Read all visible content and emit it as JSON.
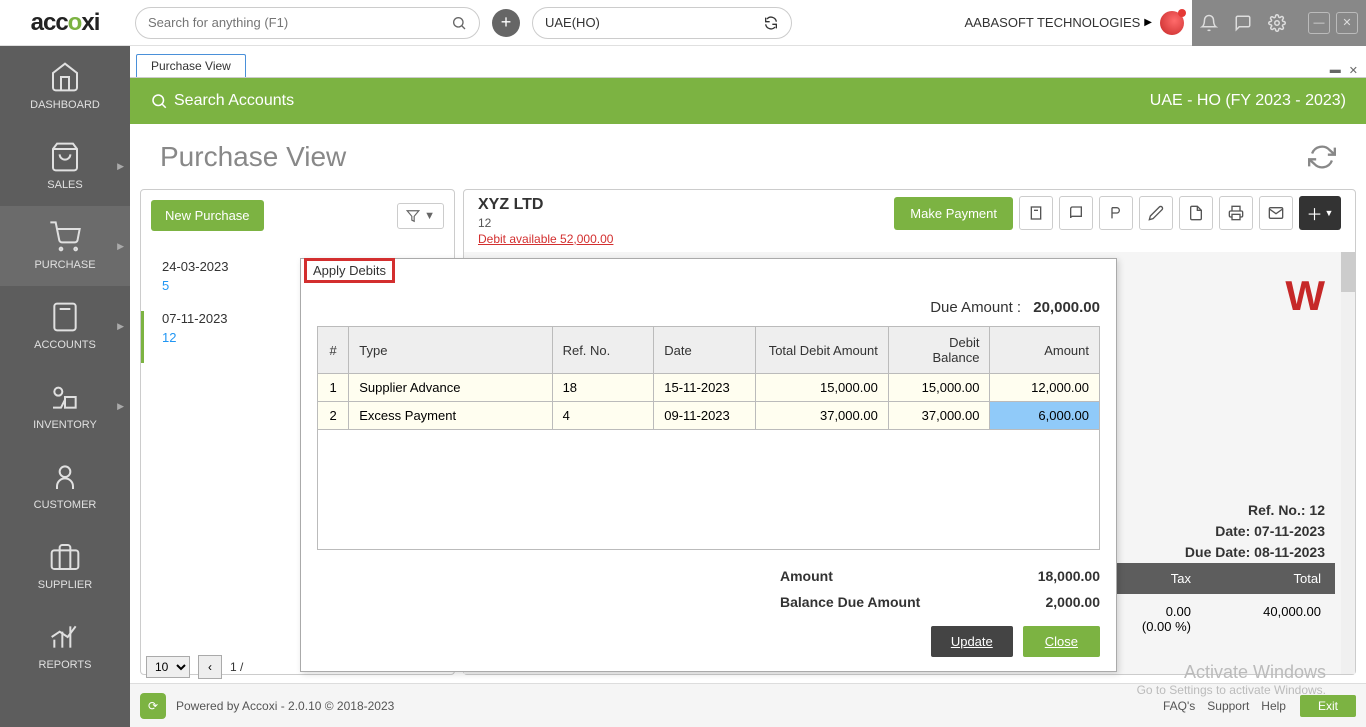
{
  "header": {
    "logo_text_pre": "acc",
    "logo_text_o": "o",
    "logo_text_post": "xi",
    "search_placeholder": "Search for anything (F1)",
    "location": "UAE(HO)",
    "company": "AABASOFT TECHNOLOGIES"
  },
  "sidebar": [
    {
      "label": "DASHBOARD"
    },
    {
      "label": "SALES"
    },
    {
      "label": "PURCHASE"
    },
    {
      "label": "ACCOUNTS"
    },
    {
      "label": "INVENTORY"
    },
    {
      "label": "CUSTOMER"
    },
    {
      "label": "SUPPLIER"
    },
    {
      "label": "REPORTS"
    }
  ],
  "tab": {
    "label": "Purchase View",
    "minimize": "▬",
    "close": "✕"
  },
  "green": {
    "search": "Search Accounts",
    "fy": "UAE - HO (FY 2023 - 2023)"
  },
  "page": {
    "title": "Purchase View"
  },
  "left_panel": {
    "new_btn": "New Purchase",
    "items": [
      {
        "date": "24-03-2023",
        "id": "5"
      },
      {
        "date": "07-11-2023",
        "id": "12"
      }
    ]
  },
  "right_panel": {
    "supplier": "XYZ LTD",
    "supplier_num": "12",
    "debit_link": "Debit available 52,000.00",
    "make_payment": "Make Payment",
    "ref_label": "Ref. No.: 12",
    "date_label": "Date: 07-11-2023",
    "due_label": "Due Date: 08-11-2023",
    "totals": {
      "tax_h": "Tax",
      "total_h": "Total",
      "tax": "0.00",
      "tax_pct": "(0.00 %)",
      "total": "40,000.00"
    }
  },
  "pagination": {
    "size": "10",
    "page_text": "1 /"
  },
  "footer": {
    "powered": "Powered by Accoxi - 2.0.10 © 2018-2023",
    "faq": "FAQ's",
    "support": "Support",
    "help": "Help",
    "exit": "Exit"
  },
  "modal": {
    "tab": "Apply Debits",
    "due_label": "Due Amount :",
    "due_value": "20,000.00",
    "cols": [
      "#",
      "Type",
      "Ref. No.",
      "Date",
      "Total Debit Amount",
      "Debit Balance",
      "Amount"
    ],
    "rows": [
      {
        "n": "1",
        "type": "Supplier Advance",
        "ref": "18",
        "date": "15-11-2023",
        "total": "15,000.00",
        "bal": "15,000.00",
        "amt": "12,000.00"
      },
      {
        "n": "2",
        "type": "Excess Payment",
        "ref": "4",
        "date": "09-11-2023",
        "total": "37,000.00",
        "bal": "37,000.00",
        "amt": "6,000.00"
      }
    ],
    "amount_lbl": "Amount",
    "amount_val": "18,000.00",
    "balance_lbl": "Balance Due Amount",
    "balance_val": "2,000.00",
    "update": "Update",
    "close": "Close"
  },
  "watermark": {
    "line1": "Activate Windows",
    "line2": "Go to Settings to activate Windows."
  }
}
